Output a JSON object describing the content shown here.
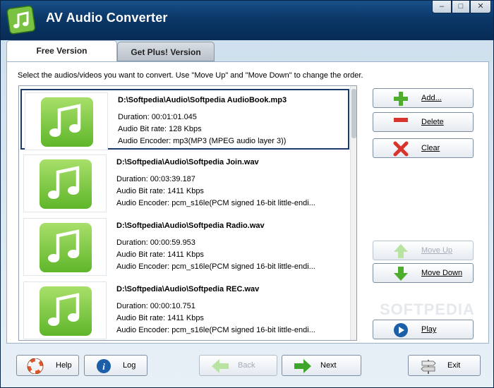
{
  "window": {
    "title": "AV Audio Converter",
    "minimize": "–",
    "maximize": "□",
    "close": "✕"
  },
  "tabs": [
    {
      "label": "Free Version",
      "active": true
    },
    {
      "label": "Get Plus! Version",
      "active": false
    }
  ],
  "instruction": "Select the audios/videos you want to convert. Use \"Move Up\" and \"Move Down\" to change the order.",
  "files": [
    {
      "name": "D:\\Softpedia\\Audio\\Softpedia AudioBook.mp3",
      "duration": "Duration: 00:01:01.045",
      "bitrate": "Audio Bit rate: 128 Kbps",
      "encoder": "Audio Encoder: mp3(MP3 (MPEG audio layer 3))"
    },
    {
      "name": "D:\\Softpedia\\Audio\\Softpedia Join.wav",
      "duration": "Duration: 00:03:39.187",
      "bitrate": "Audio Bit rate: 1411 Kbps",
      "encoder": "Audio Encoder: pcm_s16le(PCM signed 16-bit little-endi..."
    },
    {
      "name": "D:\\Softpedia\\Audio\\Softpedia Radio.wav",
      "duration": "Duration: 00:00:59.953",
      "bitrate": "Audio Bit rate: 1411 Kbps",
      "encoder": "Audio Encoder: pcm_s16le(PCM signed 16-bit little-endi..."
    },
    {
      "name": "D:\\Softpedia\\Audio\\Softpedia REC.wav",
      "duration": "Duration: 00:00:10.751",
      "bitrate": "Audio Bit rate: 1411 Kbps",
      "encoder": "Audio Encoder: pcm_s16le(PCM signed 16-bit little-endi..."
    }
  ],
  "side_buttons": {
    "add": "Add...",
    "delete": "Delete",
    "clear": "Clear",
    "move_up": "Move Up",
    "move_down": "Move Down",
    "play": "Play"
  },
  "bottom_buttons": {
    "help": "Help",
    "log": "Log",
    "back": "Back",
    "next": "Next",
    "exit": "Exit"
  },
  "watermark": "SOFTPEDIA",
  "colors": {
    "accent_green": "#5fb62a",
    "title_bar": "#0b3767",
    "delete_red": "#d9342b"
  }
}
